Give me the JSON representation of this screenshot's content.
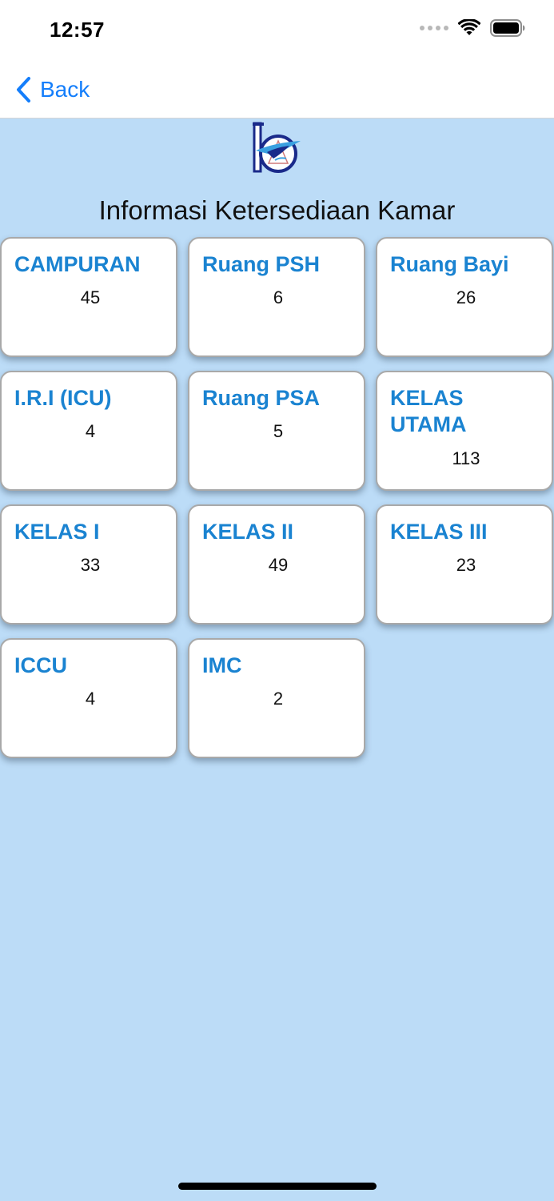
{
  "status_bar": {
    "time": "12:57"
  },
  "nav": {
    "back_label": "Back"
  },
  "page_title": "Informasi Ketersediaan Kamar",
  "rooms": [
    {
      "name": "CAMPURAN",
      "count": "45"
    },
    {
      "name": "Ruang PSH",
      "count": "6"
    },
    {
      "name": "Ruang Bayi",
      "count": "26"
    },
    {
      "name": "I.R.I (ICU)",
      "count": "4"
    },
    {
      "name": "Ruang PSA",
      "count": "5"
    },
    {
      "name": "KELAS UTAMA",
      "count": "113"
    },
    {
      "name": "KELAS I",
      "count": "33"
    },
    {
      "name": "KELAS II",
      "count": "49"
    },
    {
      "name": "KELAS III",
      "count": "23"
    },
    {
      "name": "ICCU",
      "count": "4"
    },
    {
      "name": "IMC",
      "count": "2"
    }
  ],
  "colors": {
    "background": "#bcdcf7",
    "accent": "#147efb",
    "card_title": "#1a83d1"
  },
  "icons": {
    "back": "chevron-left-icon",
    "wifi": "wifi-icon",
    "battery": "battery-icon",
    "signal": "cellular-signal-icon",
    "logo": "hospital-logo"
  }
}
